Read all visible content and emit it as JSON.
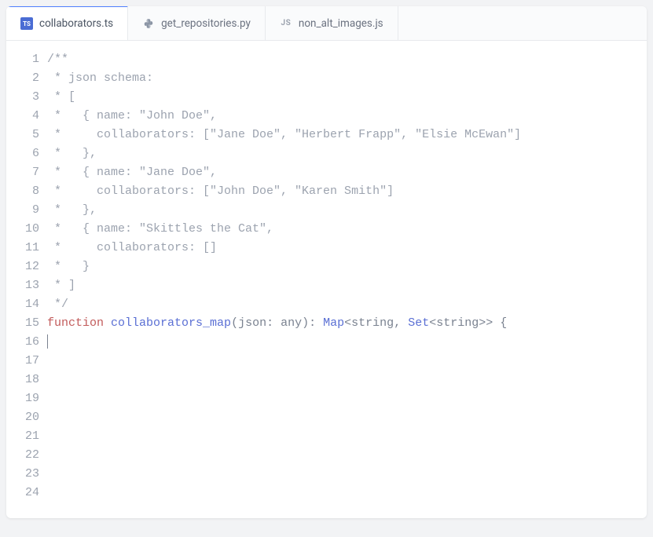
{
  "tabs": [
    {
      "label": "collaborators.ts",
      "icon": "TS",
      "active": true
    },
    {
      "label": "get_repositories.py",
      "icon": "py",
      "active": false
    },
    {
      "label": "non_alt_images.js",
      "icon": "JS",
      "active": false
    }
  ],
  "code": {
    "lines": [
      {
        "n": 1,
        "tokens": [
          {
            "t": "/**",
            "c": "comment"
          }
        ]
      },
      {
        "n": 2,
        "tokens": [
          {
            "t": " * json schema:",
            "c": "comment"
          }
        ]
      },
      {
        "n": 3,
        "tokens": [
          {
            "t": " * [",
            "c": "comment"
          }
        ]
      },
      {
        "n": 4,
        "tokens": [
          {
            "t": " *   { name: \"John Doe\",",
            "c": "comment"
          }
        ]
      },
      {
        "n": 5,
        "tokens": [
          {
            "t": " *     collaborators: [\"Jane Doe\", \"Herbert Frapp\", \"Elsie McEwan\"]",
            "c": "comment"
          }
        ]
      },
      {
        "n": 6,
        "tokens": [
          {
            "t": " *   },",
            "c": "comment"
          }
        ]
      },
      {
        "n": 7,
        "tokens": [
          {
            "t": " *   { name: \"Jane Doe\",",
            "c": "comment"
          }
        ]
      },
      {
        "n": 8,
        "tokens": [
          {
            "t": " *     collaborators: [\"John Doe\", \"Karen Smith\"]",
            "c": "comment"
          }
        ]
      },
      {
        "n": 9,
        "tokens": [
          {
            "t": " *   },",
            "c": "comment"
          }
        ]
      },
      {
        "n": 10,
        "tokens": [
          {
            "t": " *   { name: \"Skittles the Cat\",",
            "c": "comment"
          }
        ]
      },
      {
        "n": 11,
        "tokens": [
          {
            "t": " *     collaborators: []",
            "c": "comment"
          }
        ]
      },
      {
        "n": 12,
        "tokens": [
          {
            "t": " *   }",
            "c": "comment"
          }
        ]
      },
      {
        "n": 13,
        "tokens": [
          {
            "t": " * ]",
            "c": "comment"
          }
        ]
      },
      {
        "n": 14,
        "tokens": [
          {
            "t": " */",
            "c": "comment"
          }
        ]
      },
      {
        "n": 15,
        "tokens": [
          {
            "t": "function",
            "c": "keyword"
          },
          {
            "t": " ",
            "c": "punct"
          },
          {
            "t": "collaborators_map",
            "c": "funcname"
          },
          {
            "t": "(",
            "c": "punct"
          },
          {
            "t": "json",
            "c": "param"
          },
          {
            "t": ": ",
            "c": "punct"
          },
          {
            "t": "any",
            "c": "param"
          },
          {
            "t": "): ",
            "c": "punct"
          },
          {
            "t": "Map",
            "c": "type"
          },
          {
            "t": "<",
            "c": "punct"
          },
          {
            "t": "string",
            "c": "param"
          },
          {
            "t": ", ",
            "c": "punct"
          },
          {
            "t": "Set",
            "c": "type"
          },
          {
            "t": "<",
            "c": "punct"
          },
          {
            "t": "string",
            "c": "param"
          },
          {
            "t": ">> {",
            "c": "punct"
          }
        ]
      },
      {
        "n": 16,
        "tokens": [],
        "cursor": true
      },
      {
        "n": 17,
        "tokens": []
      },
      {
        "n": 18,
        "tokens": []
      },
      {
        "n": 19,
        "tokens": []
      },
      {
        "n": 20,
        "tokens": []
      },
      {
        "n": 21,
        "tokens": []
      },
      {
        "n": 22,
        "tokens": []
      },
      {
        "n": 23,
        "tokens": []
      },
      {
        "n": 24,
        "tokens": []
      }
    ]
  }
}
